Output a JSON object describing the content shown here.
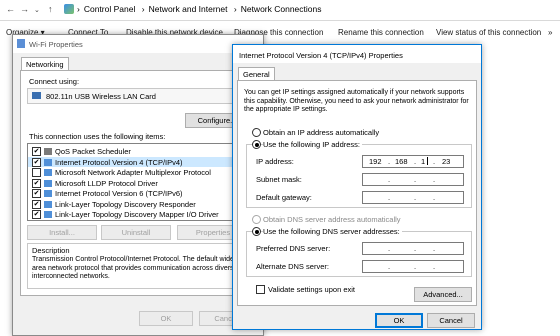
{
  "explorer": {
    "breadcrumbs": [
      "Control Panel",
      "Network and Internet",
      "Network Connections"
    ],
    "commands": [
      "Organize ▾",
      "Connect To",
      "Disable this network device",
      "Diagnose this connection",
      "Rename this connection",
      "View status of this connection",
      "»"
    ]
  },
  "wifi": {
    "title": "Wi-Fi Properties",
    "tab": "Networking",
    "connect_using_label": "Connect using:",
    "adapter": "802.11n USB Wireless LAN Card",
    "configure": "Configure...",
    "items_label": "This connection uses the following items:",
    "items": [
      {
        "label": "QoS Packet Scheduler",
        "checked": true
      },
      {
        "label": "Internet Protocol Version 4 (TCP/IPv4)",
        "checked": true
      },
      {
        "label": "Microsoft Network Adapter Multiplexor Protocol",
        "checked": false
      },
      {
        "label": "Microsoft LLDP Protocol Driver",
        "checked": true
      },
      {
        "label": "Internet Protocol Version 6 (TCP/IPv6)",
        "checked": true
      },
      {
        "label": "Link-Layer Topology Discovery Responder",
        "checked": true
      },
      {
        "label": "Link-Layer Topology Discovery Mapper I/O Driver",
        "checked": true
      }
    ],
    "install": "Install...",
    "uninstall": "Uninstall",
    "properties": "Properties",
    "description_title": "Description",
    "description": "Transmission Control Protocol/Internet Protocol. The default wide area network protocol that provides communication across diverse interconnected networks.",
    "ok": "OK",
    "cancel": "Cancel"
  },
  "ipv4": {
    "title": "Internet Protocol Version 4 (TCP/IPv4) Properties",
    "tab": "General",
    "intro": "You can get IP settings assigned automatically if your network supports this capability. Otherwise, you need to ask your network administrator for the appropriate IP settings.",
    "obtain_ip_auto": "Obtain an IP address automatically",
    "use_following_ip": "Use the following IP address:",
    "ip_label": "IP address:",
    "ip": [
      "192",
      "168",
      "1",
      "23"
    ],
    "subnet_label": "Subnet mask:",
    "gateway_label": "Default gateway:",
    "obtain_dns_auto": "Obtain DNS server address automatically",
    "use_following_dns": "Use the following DNS server addresses:",
    "preferred_dns_label": "Preferred DNS server:",
    "alternate_dns_label": "Alternate DNS server:",
    "validate": "Validate settings upon exit",
    "advanced": "Advanced...",
    "ok": "OK",
    "cancel": "Cancel",
    "ip_dot": "."
  }
}
